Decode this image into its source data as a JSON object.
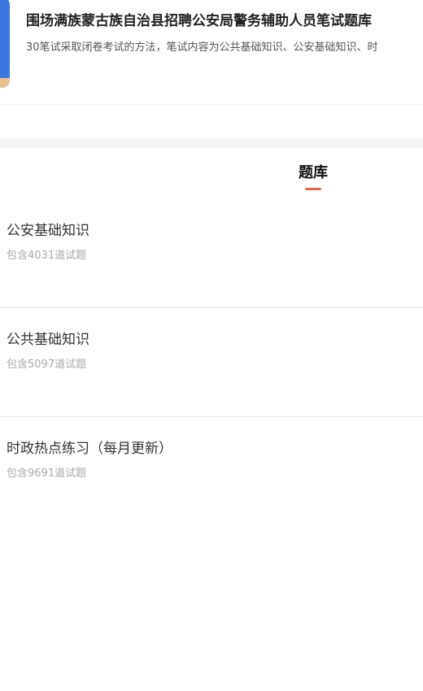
{
  "book": {
    "title": "围场满族蒙古族自治县招聘公安局警务辅助人员笔试题库",
    "description": "30笔试采取闭卷考试的方法，笔试内容为公共基础知识、公安基础知识、时",
    "cover_icon": "book-cover-image"
  },
  "tabs": [
    {
      "label": "题库",
      "active": true
    }
  ],
  "colors": {
    "accent": "#e8664a",
    "cover": "#3a78e0"
  },
  "question_banks": [
    {
      "title": "公安基础知识",
      "count": "包含4031道试题"
    },
    {
      "title": "公共基础知识",
      "count": "包含5097道试题"
    },
    {
      "title": "时政热点练习（每月更新）",
      "count": "包含9691道试题"
    }
  ]
}
